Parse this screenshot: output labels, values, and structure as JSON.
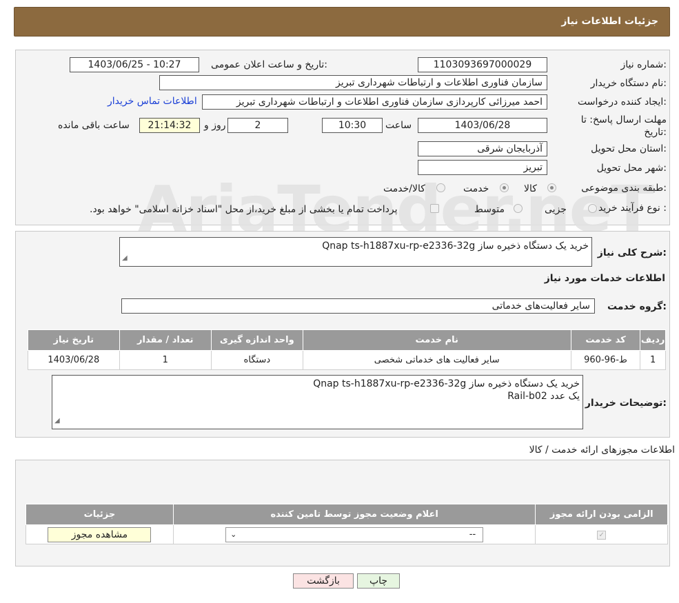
{
  "header": {
    "title": "جزئیات اطلاعات نیاز"
  },
  "info": {
    "need_number_label": "شماره نیاز:",
    "need_number": "1103093697000029",
    "announce_label": "تاریخ و ساعت اعلان عمومی:",
    "announce_value": "1403/06/25 - 10:27",
    "buyer_label": "نام دستگاه خریدار:",
    "buyer_value": "سازمان فناوری اطلاعات و ارتباطات شهرداری تبریز",
    "creator_label": "ایجاد کننده درخواست:",
    "creator_value": "احمد میرزائی کارپردازی سازمان فناوری اطلاعات و ارتباطات شهرداری تبریز",
    "contact_link": "اطلاعات تماس خریدار",
    "deadline_label": "مهلت ارسال پاسخ: تا تاریخ:",
    "deadline_date": "1403/06/28",
    "time_label": "ساعت",
    "deadline_time": "10:30",
    "days_value": "2",
    "days_label": "روز و",
    "remaining_time": "21:14:32",
    "remaining_label": "ساعت باقی مانده",
    "province_label": "استان محل تحویل:",
    "province_value": "آذربایجان شرقی",
    "city_label": "شهر محل تحویل:",
    "city_value": "تبریز",
    "category_label": "طبقه بندی موضوعی:",
    "category_options": [
      "کالا",
      "خدمت",
      "کالا/خدمت"
    ],
    "process_label": "نوع فرآیند خرید :",
    "process_options": [
      "جزیی",
      "متوسط"
    ],
    "payment_note": "پرداخت تمام یا بخشی از مبلغ خرید،از محل \"اسناد خزانه اسلامی\" خواهد بود."
  },
  "watermark": "AriaTender.neT",
  "details": {
    "summary_label": "شرح کلی نیاز:",
    "summary_value": "خرید یک دستگاه ذخیره ساز Qnap ts-h1887xu-rp-e2336-32g",
    "services_title": "اطلاعات خدمات مورد نیاز",
    "service_group_label": "گروه خدمت:",
    "service_group_value": "سایر فعالیت‌های خدماتی",
    "table": {
      "headers": [
        "ردیف",
        "کد خدمت",
        "نام خدمت",
        "واحد اندازه گیری",
        "تعداد / مقدار",
        "تاریخ نیاز"
      ],
      "rows": [
        [
          "1",
          "ط-96-960",
          "سایر فعالیت های خدماتی شخصی",
          "دستگاه",
          "1",
          "1403/06/28"
        ]
      ]
    },
    "buyer_notes_label": "توضیحات خریدار:",
    "buyer_notes_line1": "خرید یک دستگاه ذخیره ساز Qnap ts-h1887xu-rp-e2336-32g",
    "buyer_notes_line2": "یک عدد Rail-b02"
  },
  "permits": {
    "title": "اطلاعات مجوزهای ارائه خدمت / کالا",
    "headers": [
      "الزامی بودن ارائه مجوز",
      "اعلام وضعیت مجوز توسط تامین کننده",
      "جزئیات"
    ],
    "select_value": "--",
    "view_button": "مشاهده مجوز"
  },
  "actions": {
    "print": "چاپ",
    "back": "بازگشت"
  }
}
